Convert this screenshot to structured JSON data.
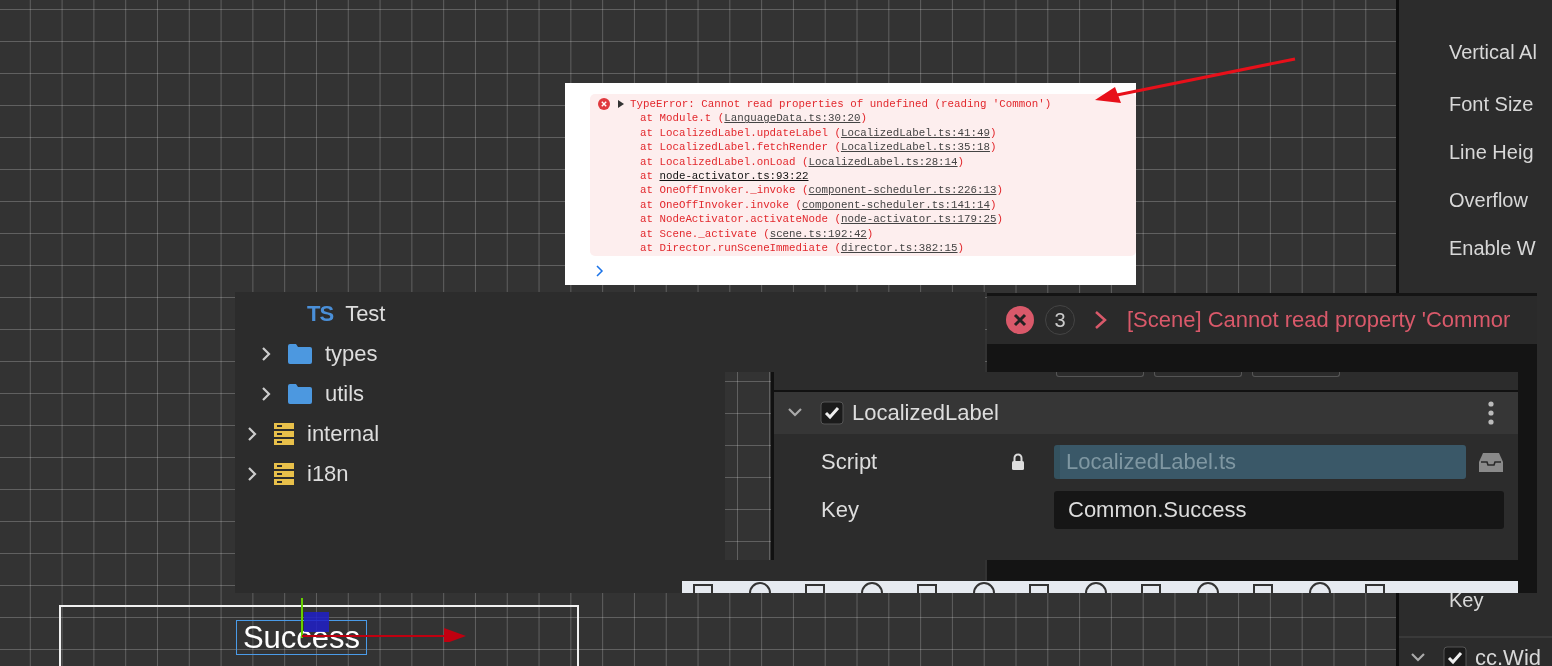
{
  "console": {
    "error": {
      "message": "TypeError: Cannot read properties of undefined (reading 'Common')",
      "expanded": false
    },
    "frames": [
      {
        "kind": "named",
        "at": "at",
        "func": "Module.t",
        "open": "(",
        "location": "LanguageData.ts:30:20",
        "close": ")"
      },
      {
        "kind": "named",
        "at": "at",
        "func": "LocalizedLabel.updateLabel",
        "open": "(",
        "location": "LocalizedLabel.ts:41:49",
        "close": ")"
      },
      {
        "kind": "named",
        "at": "at",
        "func": "LocalizedLabel.fetchRender",
        "open": "(",
        "location": "LocalizedLabel.ts:35:18",
        "close": ")"
      },
      {
        "kind": "named",
        "at": "at",
        "func": "LocalizedLabel.onLoad",
        "open": "(",
        "location": "LocalizedLabel.ts:28:14",
        "close": ")"
      },
      {
        "kind": "anonymous",
        "at": "at",
        "location": "node-activator.ts:93:22"
      },
      {
        "kind": "named",
        "at": "at",
        "func": "OneOffInvoker._invoke",
        "open": "(",
        "location": "component-scheduler.ts:226:13",
        "close": ")"
      },
      {
        "kind": "named",
        "at": "at",
        "func": "OneOffInvoker.invoke",
        "open": "(",
        "location": "component-scheduler.ts:141:14",
        "close": ")"
      },
      {
        "kind": "named",
        "at": "at",
        "func": "NodeActivator.activateNode",
        "open": "(",
        "location": "node-activator.ts:179:25",
        "close": ")"
      },
      {
        "kind": "named",
        "at": "at",
        "func": "Scene._activate",
        "open": "(",
        "location": "scene.ts:192:42",
        "close": ")"
      },
      {
        "kind": "named",
        "at": "at",
        "func": "Director.runSceneImmediate",
        "open": "(",
        "location": "director.ts:382:15",
        "close": ")"
      }
    ]
  },
  "assets": {
    "tree": [
      {
        "children": [
          {
            "kind": "script",
            "badge": "TS",
            "label": "Test"
          },
          {
            "kind": "folder",
            "label": "types",
            "expanded": false
          },
          {
            "kind": "folder",
            "label": "utils",
            "expanded": false
          }
        ]
      },
      {
        "kind": "bundle",
        "label": "internal",
        "expanded": false
      },
      {
        "kind": "bundle",
        "label": "i18n",
        "expanded": false
      }
    ]
  },
  "error_bar": {
    "count": "3",
    "message": "[Scene] Cannot read property 'Commor"
  },
  "inspector": {
    "component": {
      "name": "LocalizedLabel",
      "enabled": true,
      "expanded": true
    },
    "properties": [
      {
        "kind": "asset",
        "label": "Script",
        "value": "LocalizedLabel.ts",
        "locked": true
      },
      {
        "kind": "text",
        "label": "Key",
        "value": "Common.Success",
        "locked": false
      }
    ]
  },
  "side_inspector": {
    "labels": [
      "Vertical Al",
      "Font Size",
      "Line Heig",
      "Overflow",
      "Enable W"
    ],
    "key_label": "Key",
    "component": {
      "name": "cc.Wid",
      "enabled": true,
      "expanded": true
    }
  },
  "scene": {
    "label": "Success",
    "selected": true
  }
}
